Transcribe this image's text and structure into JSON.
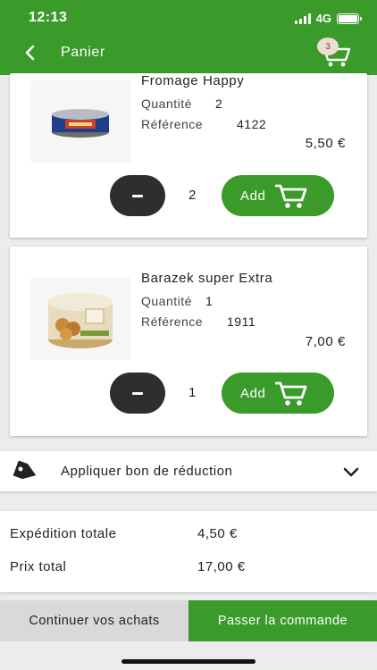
{
  "status_bar": {
    "time": "12:13",
    "network": "4G"
  },
  "header": {
    "title": "Panier",
    "cart_count": "3"
  },
  "items": [
    {
      "name": "Fromage Happy",
      "quantity_label": "Quantité",
      "quantity_value": "2",
      "reference_label": "Référence",
      "reference_value": "4122",
      "price": "5,50 €",
      "qty": "2",
      "add_label": "Add"
    },
    {
      "name": "Barazek super Extra",
      "quantity_label": "Quantité",
      "quantity_value": "1",
      "reference_label": "Référence",
      "reference_value": "1911",
      "price": "7,00 €",
      "qty": "1",
      "add_label": "Add"
    }
  ],
  "coupon": {
    "label": "Appliquer bon de réduction"
  },
  "totals": {
    "shipping_label": "Expédition totale",
    "shipping_value": "4,50 €",
    "total_label": "Prix total",
    "total_value": "17,00 €"
  },
  "actions": {
    "continue_label": "Continuer vos achats",
    "checkout_label": "Passer la commande"
  },
  "colors": {
    "brand_green": "#3a9a2a",
    "dark_button": "#2e2e2e",
    "secondary_button": "#d9d9d9"
  },
  "icons": [
    "back-chevron-icon",
    "cart-icon",
    "tag-icon",
    "chevron-down-icon",
    "add-cart-icon"
  ]
}
